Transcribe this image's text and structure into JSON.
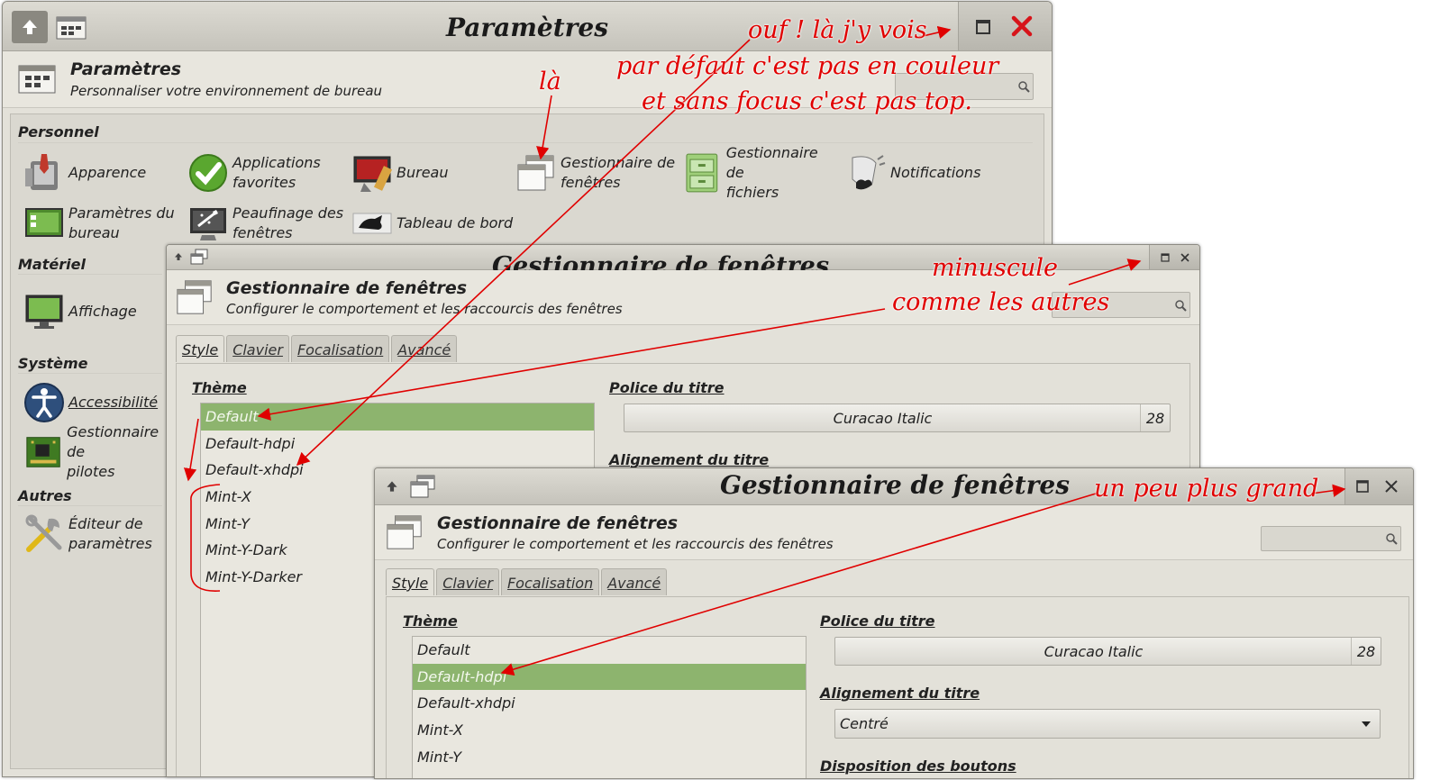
{
  "window1": {
    "title": "Paramètres",
    "header": {
      "title": "Paramètres",
      "subtitle": "Personnaliser votre environnement de bureau"
    },
    "categories": [
      {
        "name": "Personnel",
        "items": [
          {
            "label": "Apparence",
            "icon": "appearance-icon"
          },
          {
            "label": "Applications\nfavorites",
            "icon": "checkmark-icon"
          },
          {
            "label": "Bureau",
            "icon": "desktop-icon"
          },
          {
            "label": "Gestionnaire de\nfenêtres",
            "icon": "window-manager-icon"
          },
          {
            "label": "Gestionnaire de\nfichiers",
            "icon": "file-manager-icon"
          },
          {
            "label": "Notifications",
            "icon": "notifications-icon"
          },
          {
            "label": "Paramètres du\nbureau",
            "icon": "desktop-settings-icon"
          },
          {
            "label": "Peaufinage des\nfenêtres",
            "icon": "window-tweaks-icon"
          },
          {
            "label": "Tableau de bord",
            "icon": "panel-icon"
          }
        ]
      },
      {
        "name": "Matériel",
        "items": [
          {
            "label": "Affichage",
            "icon": "display-icon"
          }
        ]
      },
      {
        "name": "Système",
        "items": [
          {
            "label": "Accessibilité",
            "icon": "accessibility-icon"
          },
          {
            "label": "Gestionnaire de\npilotes",
            "icon": "driver-icon"
          }
        ]
      },
      {
        "name": "Autres",
        "items": [
          {
            "label": "Éditeur de\nparamètres",
            "icon": "tools-icon"
          }
        ]
      }
    ]
  },
  "window2": {
    "title": "Gestionnaire de fenêtres",
    "header": {
      "title": "Gestionnaire de fenêtres",
      "subtitle": "Configurer le comportement et les raccourcis des fenêtres"
    },
    "tabs": [
      "Style",
      "Clavier",
      "Focalisation",
      "Avancé"
    ],
    "theme_label": "Thème",
    "themes": [
      "Default",
      "Default-hdpi",
      "Default-xhdpi",
      "Mint-X",
      "Mint-Y",
      "Mint-Y-Dark",
      "Mint-Y-Darker"
    ],
    "selected_theme": "Default",
    "font_label": "Police du titre",
    "font_name": "Curacao Italic",
    "font_size": "28",
    "align_label": "Alignement du titre"
  },
  "window3": {
    "title": "Gestionnaire de fenêtres",
    "header": {
      "title": "Gestionnaire de fenêtres",
      "subtitle": "Configurer le comportement et les raccourcis des fenêtres"
    },
    "tabs": [
      "Style",
      "Clavier",
      "Focalisation",
      "Avancé"
    ],
    "theme_label": "Thème",
    "themes": [
      "Default",
      "Default-hdpi",
      "Default-xhdpi",
      "Mint-X",
      "Mint-Y"
    ],
    "selected_theme": "Default-hdpi",
    "font_label": "Police du titre",
    "font_name": "Curacao Italic",
    "font_size": "28",
    "align_label": "Alignement du titre",
    "align_value": "Centré",
    "layout_label": "Disposition des boutons"
  },
  "annotations": {
    "a1": "ouf ! là j'y vois",
    "a2": "par défaut c'est pas en couleur",
    "a3": "et sans focus c'est pas top.",
    "a4": "là",
    "a5": "minuscule",
    "a6": "comme les autres",
    "a7": "un peu plus grand"
  },
  "colors": {
    "selection": "#8db46e",
    "annotation": "#e00000",
    "close_red": "#d7141a",
    "window_bg": "#e3e1d9"
  }
}
